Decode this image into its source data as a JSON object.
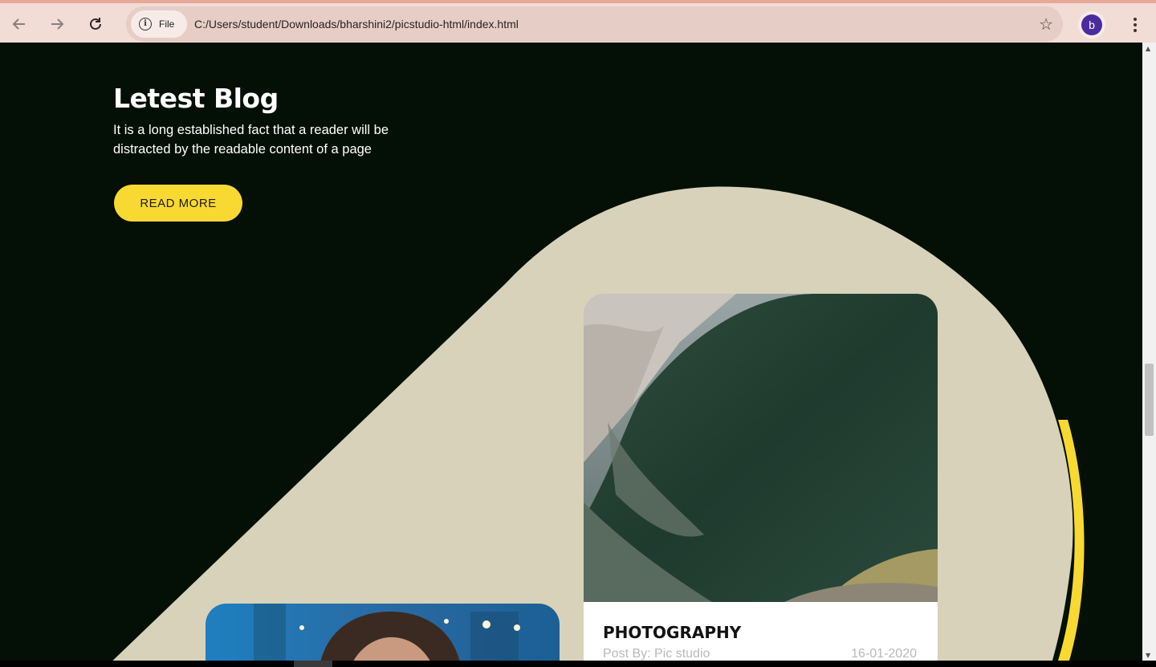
{
  "browser": {
    "back_icon": "arrow-left-icon",
    "forward_icon": "arrow-right-icon",
    "reload_icon": "reload-icon",
    "site_chip_label": "File",
    "url": "C:/Users/student/Downloads/bharshini2/picstudio-html/index.html",
    "profile_initial": "b",
    "bookmark_icon": "star-icon",
    "menu_icon": "kebab-menu-icon"
  },
  "blog": {
    "heading": "Letest Blog",
    "description": "It is a long established fact that a reader will be distracted by the readable content of a page",
    "read_more_label": "READ MORE"
  },
  "cards": [
    {
      "category": "PHOTOGRAPHY",
      "author": "Post By: Pic studio",
      "date": "16-01-2020"
    }
  ],
  "colors": {
    "page_background": "#040f06",
    "blob": "#d7d2b9",
    "accent_yellow": "#f8d931",
    "chrome_background": "#f2dcd6"
  }
}
